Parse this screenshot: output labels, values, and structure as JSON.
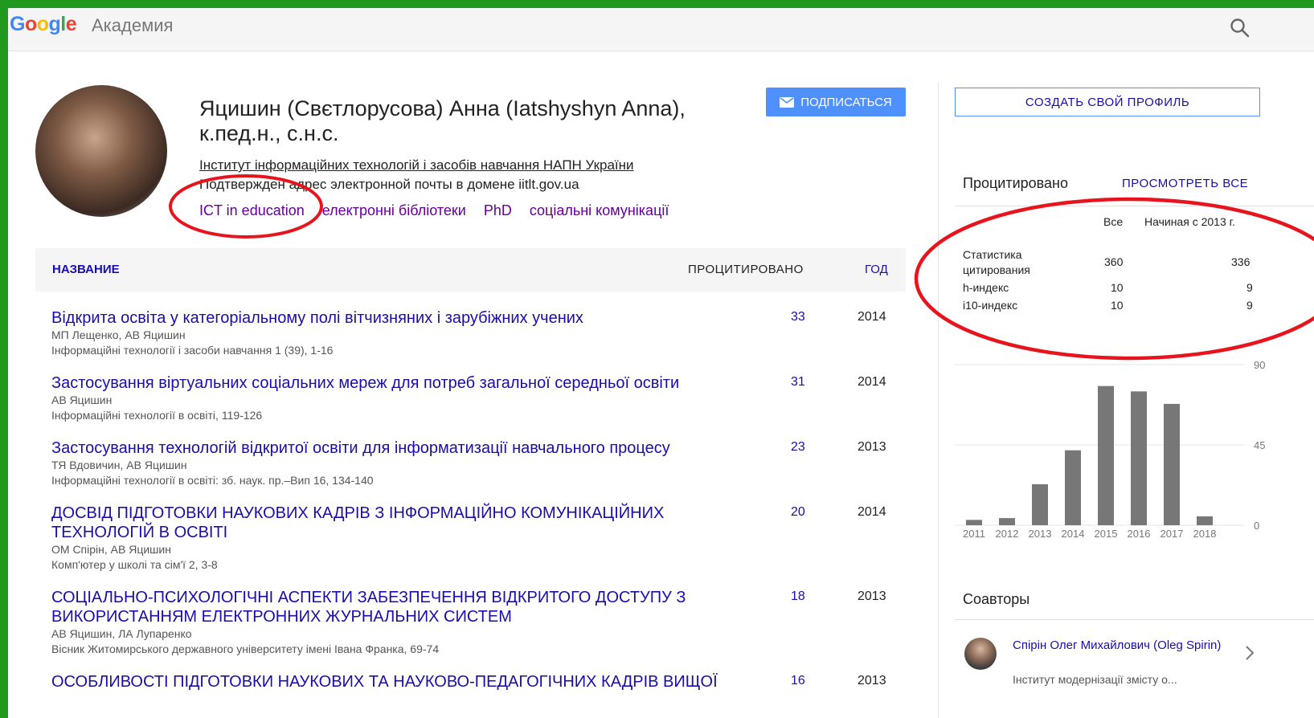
{
  "header": {
    "logo_text": "Google",
    "product_name": "Академия",
    "search_icon": "search-icon"
  },
  "profile": {
    "name": "Яцишин (Свєтлорусова) Анна (Iatshyshyn Anna), к.пед.н., с.н.с.",
    "affiliation": "Інститут інформаційних технологій і засобів навчання НАПН України",
    "email_verified": "Подтвержден адрес электронной почты в домене iitlt.gov.ua",
    "interests": [
      "ICT in education",
      "електронні бібліотеки",
      "PhD",
      "соціальні комунікації"
    ],
    "follow_label": "ПОДПИСАТЬСЯ"
  },
  "table": {
    "col_title": "НАЗВАНИЕ",
    "col_cited": "ПРОЦИТИРОВАНО",
    "col_year": "ГОД",
    "rows": [
      {
        "title": "Відкрита освіта у категоріальному полі вітчизняних і зарубіжних учених",
        "authors": "МП Лещенко, АВ Яцишин",
        "venue": "Інформаційні технології і засоби навчання 1 (39), 1-16",
        "cited": "33",
        "year": "2014"
      },
      {
        "title": "Застосування віртуальних соціальних мереж для потреб загальної середньої освіти",
        "authors": "АВ Яцишин",
        "venue": "Інформаційні технології в освіті, 119-126",
        "cited": "31",
        "year": "2014"
      },
      {
        "title": "Застосування технологій відкритої освіти для інформатизації навчального процесу",
        "authors": "ТЯ Вдовичин, АВ Яцишин",
        "venue": "Інформаційні технології в освіті: зб. наук. пр.–Вип 16, 134-140",
        "cited": "23",
        "year": "2013"
      },
      {
        "title": "ДОСВІД ПІДГОТОВКИ НАУКОВИХ КАДРІВ З ІНФОРМАЦІЙНО КОМУНІКАЦІЙНИХ ТЕХНОЛОГІЙ В ОСВІТІ",
        "authors": "ОМ Спірін, АВ Яцишин",
        "venue": "Комп'ютер у школі та сім'ї 2, 3-8",
        "cited": "20",
        "year": "2014"
      },
      {
        "title": "СОЦІАЛЬНО-ПСИХОЛОГІЧНІ АСПЕКТИ ЗАБЕЗПЕЧЕННЯ ВІДКРИТОГО ДОСТУПУ З ВИКОРИСТАННЯМ ЕЛЕКТРОННИХ ЖУРНАЛЬНИХ СИСТЕМ",
        "authors": "АВ Яцишин, ЛА Лупаренко",
        "venue": "Вісник Житомирського державного університету імені Івана Франка, 69-74",
        "cited": "18",
        "year": "2013"
      },
      {
        "title": "ОСОБЛИВОСТІ ПІДГОТОВКИ НАУКОВИХ ТА НАУКОВО-ПЕДАГОГІЧНИХ КАДРІВ ВИЩОЇ",
        "authors": "",
        "venue": "",
        "cited": "16",
        "year": "2013"
      }
    ]
  },
  "sidebar": {
    "create_profile_label": "СОЗДАТЬ СВОЙ ПРОФИЛЬ",
    "cited_by_title": "Процитировано",
    "view_all_label": "ПРОСМОТРЕТЬ ВСЕ",
    "col_all": "Все",
    "col_since": "Начиная с 2013 г.",
    "stats": [
      {
        "label": "Статистика цитирования",
        "all": "360",
        "since": "336"
      },
      {
        "label": "h-индекс",
        "all": "10",
        "since": "9"
      },
      {
        "label": "i10-индекс",
        "all": "10",
        "since": "9"
      }
    ],
    "coauthors_title": "Соавторы",
    "coauthor": {
      "name": "Спірін Олег Михайлович (Oleg Spirin)",
      "institution": "Інститут модернізації змісту о..."
    }
  },
  "chart_data": {
    "type": "bar",
    "categories": [
      "2011",
      "2012",
      "2013",
      "2014",
      "2015",
      "2016",
      "2017",
      "2018"
    ],
    "values": [
      3,
      4,
      23,
      42,
      78,
      75,
      68,
      5
    ],
    "ylim": [
      0,
      90
    ],
    "yticks": [
      "0",
      "45",
      "90"
    ],
    "bar_color": "#777777",
    "grid": true
  },
  "colors": {
    "link": "#1a0dab",
    "visited": "#660099",
    "accent_button": "#4d90fe",
    "annotation_red": "#e8141d",
    "frame_green": "#1f9a1f"
  }
}
